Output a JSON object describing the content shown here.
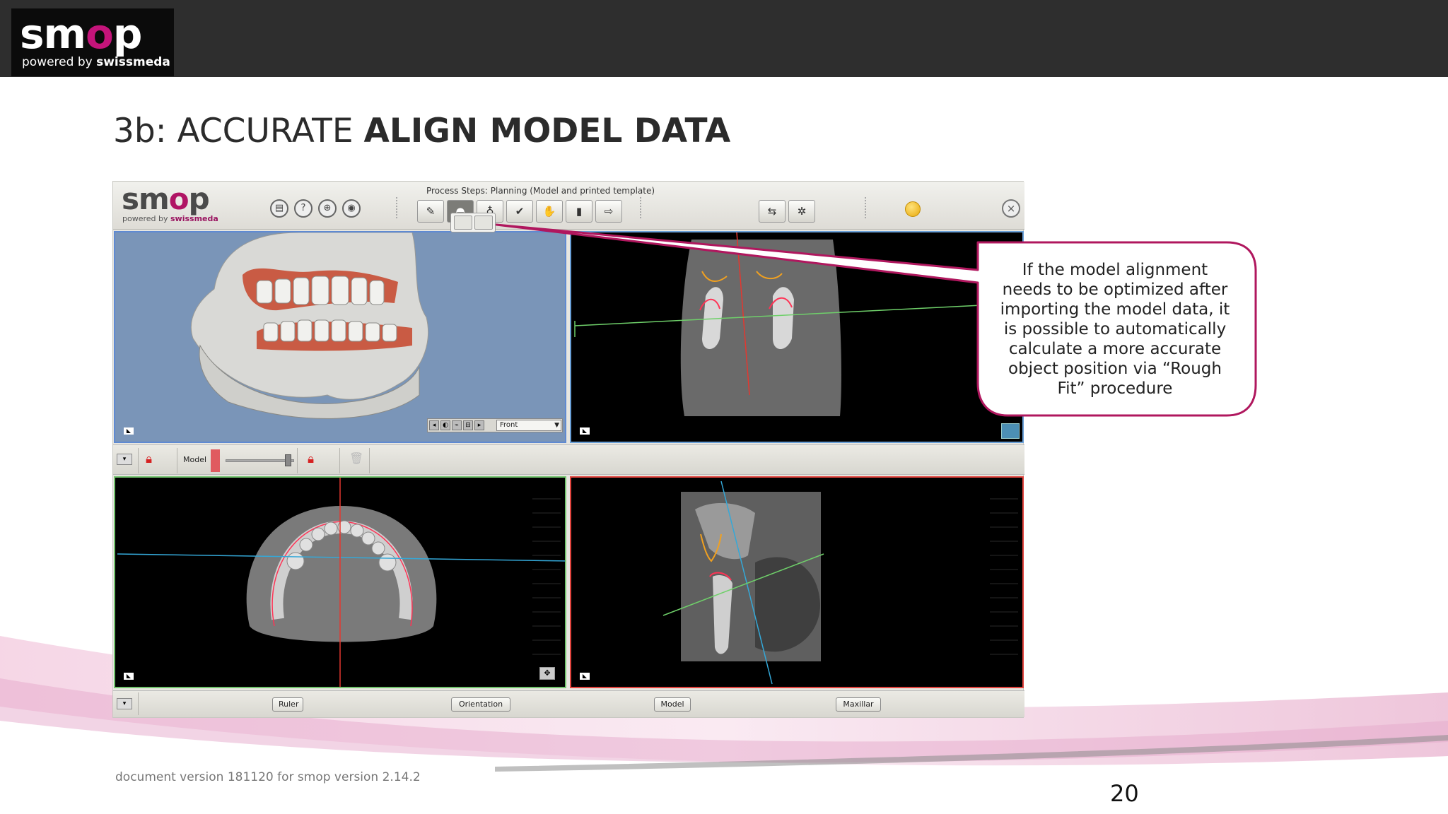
{
  "header": {
    "logo_text_pre": "sm",
    "logo_text_o": "o",
    "logo_text_post": "p",
    "logo_tagline_pre": "powered by ",
    "logo_tagline_brand": "swissmeda"
  },
  "slide": {
    "title_normal": "3b: ACCURATE ",
    "title_bold": "ALIGN MODEL DATA",
    "footer_note": "document version 181120 for smop version 2.14.2",
    "page_number": "20"
  },
  "app": {
    "logo_pre": "sm",
    "logo_o": "o",
    "logo_post": "p",
    "logo_sub_pre": "powered by ",
    "logo_sub_brand": "swissmeda",
    "process_steps_label": "Process Steps: Planning (Model and printed template)",
    "view3d_orientation": "Front",
    "mid_bar_model_label": "Model",
    "bottom_buttons": {
      "ruler": "Ruler",
      "orientation": "Orientation",
      "model": "Model",
      "maxillar": "Maxillar"
    }
  },
  "callout": {
    "text": "If the model alignment\nneeds to be optimized after\nimporting the model data, it\nis possible to automatically\ncalculate a more accurate\nobject position via “Rough\nFit” procedure"
  },
  "colors": {
    "brand_magenta": "#c4147a",
    "callout_border": "#b0175e",
    "header_bg": "#2e2e2e"
  }
}
